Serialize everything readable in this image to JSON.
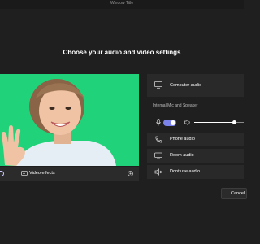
{
  "window": {
    "title": "Window Title"
  },
  "heading": "Choose your audio and video settings",
  "video": {
    "effects_label": "Video effects",
    "camera_on": true
  },
  "audio": {
    "computer_audio_label": "Computer audio",
    "device_label": "Internal Mic and Speaker",
    "mic_on": true,
    "volume_level": 0.8,
    "phone_audio_label": "Phone audio",
    "room_audio_label": "Room audio",
    "no_audio_label": "Dont use audio"
  },
  "actions": {
    "cancel_label": "Cancel"
  },
  "colors": {
    "background": "#1f1f1f",
    "panel": "#292929",
    "accent": "#7b83eb",
    "video_background": "#20d27a"
  }
}
